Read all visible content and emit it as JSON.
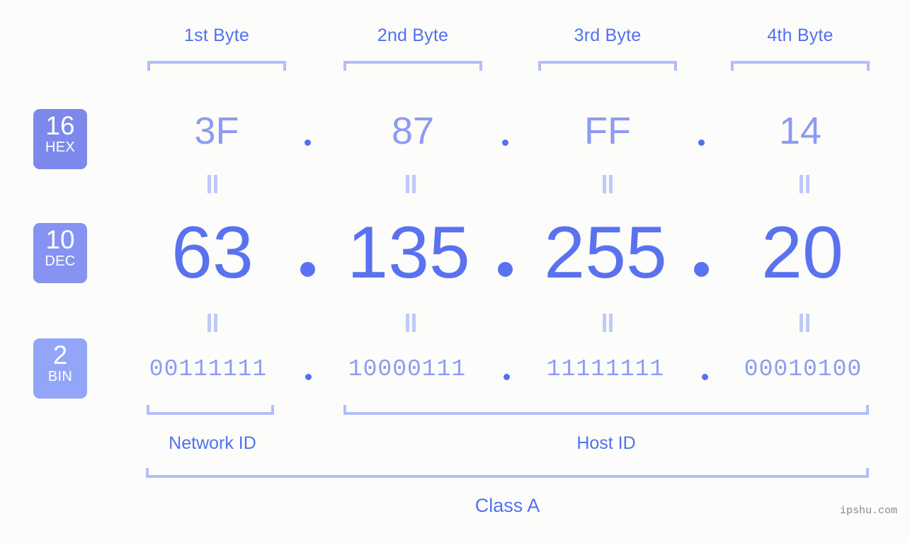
{
  "title": "IP Address Byte Breakdown",
  "background_color": "#fcfdfa",
  "colors": {
    "accent_strong": "#5271f0",
    "accent_mid": "#8e9bf2",
    "accent_light": "#b3bdfb",
    "badge_hex": "#7d89ea",
    "badge_dec": "#8793f2",
    "badge_bin": "#93a5f9",
    "watermark": "#888888"
  },
  "byte_headers": [
    {
      "label": "1st Byte"
    },
    {
      "label": "2nd Byte"
    },
    {
      "label": "3rd Byte"
    },
    {
      "label": "4th Byte"
    }
  ],
  "bases": [
    {
      "key": "hex",
      "radix": "16",
      "abbr": "HEX"
    },
    {
      "key": "dec",
      "radix": "10",
      "abbr": "DEC"
    },
    {
      "key": "bin",
      "radix": "2",
      "abbr": "BIN"
    }
  ],
  "separator": ".",
  "values": {
    "hex": [
      "3F",
      "87",
      "FF",
      "14"
    ],
    "dec": [
      "63",
      "135",
      "255",
      "20"
    ],
    "bin": [
      "00111111",
      "10000111",
      "11111111",
      "00010100"
    ]
  },
  "equals_mark": "||",
  "segments": {
    "network_id": "Network ID",
    "host_id": "Host ID"
  },
  "class_label": "Class A",
  "watermark": "ipshu.com"
}
